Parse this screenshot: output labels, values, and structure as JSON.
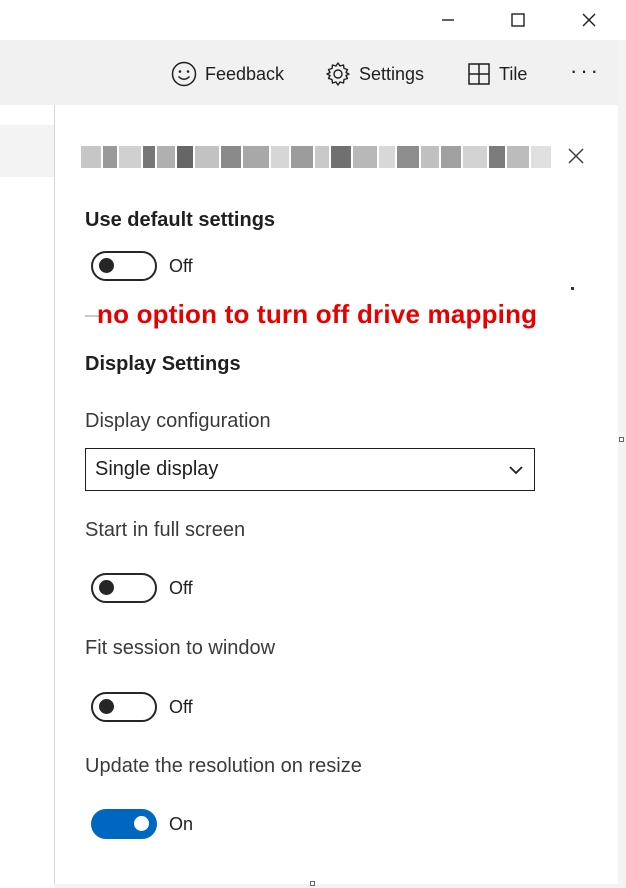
{
  "window": {
    "controls": [
      "minimize",
      "maximize",
      "close"
    ]
  },
  "toolbar": {
    "feedback_label": "Feedback",
    "settings_label": "Settings",
    "tile_label": "Tile",
    "more_label": "···"
  },
  "panel": {
    "use_default": {
      "heading": "Use default settings",
      "state": "Off"
    },
    "annotation": "no option to turn off drive mapping",
    "display_heading": "Display Settings",
    "display_configuration": {
      "label": "Display configuration",
      "value": "Single display"
    },
    "full_screen": {
      "label": "Start in full screen",
      "state": "Off"
    },
    "fit_session": {
      "label": "Fit session to window",
      "state": "Off"
    },
    "update_resolution": {
      "label": "Update the resolution on resize",
      "state": "On"
    }
  },
  "colors": {
    "accent": "#0067c0",
    "annotation": "#e60000"
  }
}
